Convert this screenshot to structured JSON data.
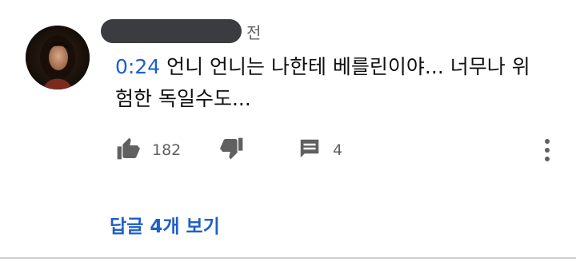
{
  "comment": {
    "author_redacted": true,
    "timestamp_suffix": "전",
    "timecode": "0:24",
    "text": " 언니 언니는 나한테 베를린이야... 너무나 위험한 독일수도...",
    "like_count": "182",
    "reply_count": "4",
    "view_replies_label": "답글 4개 보기"
  },
  "icons": {
    "like": "thumbs-up-icon",
    "dislike": "thumbs-down-icon",
    "reply": "comment-icon",
    "more": "more-vertical-icon"
  },
  "colors": {
    "link_blue": "#1e5fc8",
    "icon_gray": "#606060",
    "redaction": "#3a3c40"
  }
}
